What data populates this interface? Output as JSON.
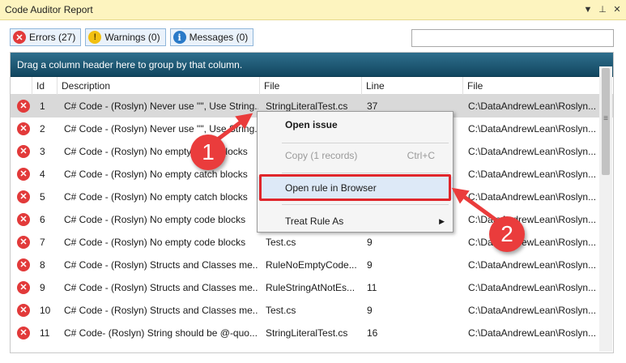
{
  "window": {
    "title": "Code Auditor Report",
    "dropdown_glyph": "▼",
    "pin_glyph": "⊥",
    "close_glyph": "✕"
  },
  "filters": {
    "errors_label": "Errors (27)",
    "warnings_label": "Warnings (0)",
    "messages_label": "Messages (0)",
    "error_icon_glyph": "✕",
    "warning_icon_glyph": "!",
    "info_icon_glyph": "i"
  },
  "search": {
    "value": "",
    "placeholder": ""
  },
  "grid": {
    "group_hint": "Drag a column header here to group by that column.",
    "columns": {
      "id": "Id",
      "description": "Description",
      "file": "File",
      "line": "Line",
      "file_path": "File"
    },
    "rows": [
      {
        "id": "1",
        "description": "C# Code - (Roslyn) Never use \"\", Use String...",
        "file": "StringLiteralTest.cs",
        "line": "37",
        "path": "C:\\DataAndrewLean\\Roslyn..."
      },
      {
        "id": "2",
        "description": "C# Code - (Roslyn) Never use \"\", Use String...",
        "file": "",
        "line": "",
        "path": "C:\\DataAndrewLean\\Roslyn..."
      },
      {
        "id": "3",
        "description": "C# Code - (Roslyn) No empty catch blocks",
        "file": "",
        "line": "",
        "path": "C:\\DataAndrewLean\\Roslyn..."
      },
      {
        "id": "4",
        "description": "C# Code - (Roslyn) No empty catch blocks",
        "file": "",
        "line": "",
        "path": "C:\\DataAndrewLean\\Roslyn..."
      },
      {
        "id": "5",
        "description": "C# Code - (Roslyn) No empty catch blocks",
        "file": "",
        "line": "",
        "path": "C:\\DataAndrewLean\\Roslyn..."
      },
      {
        "id": "6",
        "description": "C# Code - (Roslyn) No empty code blocks",
        "file": "",
        "line": "",
        "path": "C:\\DataAndrewLean\\Roslyn..."
      },
      {
        "id": "7",
        "description": "C# Code - (Roslyn) No empty code blocks",
        "file": "Test.cs",
        "line": "9",
        "path": "C:\\DataAndrewLean\\Roslyn..."
      },
      {
        "id": "8",
        "description": "C# Code - (Roslyn) Structs and Classes me...",
        "file": "RuleNoEmptyCode...",
        "line": "9",
        "path": "C:\\DataAndrewLean\\Roslyn..."
      },
      {
        "id": "9",
        "description": "C# Code - (Roslyn) Structs and Classes me...",
        "file": "RuleStringAtNotEs...",
        "line": "11",
        "path": "C:\\DataAndrewLean\\Roslyn..."
      },
      {
        "id": "10",
        "description": "C# Code - (Roslyn) Structs and Classes me...",
        "file": "Test.cs",
        "line": "9",
        "path": "C:\\DataAndrewLean\\Roslyn..."
      },
      {
        "id": "11",
        "description": "C# Code- (Roslyn) String should be @-quo...",
        "file": "StringLiteralTest.cs",
        "line": "16",
        "path": "C:\\DataAndrewLean\\Roslyn..."
      }
    ],
    "scroll_grip": "≡"
  },
  "context_menu": {
    "open_issue": "Open issue",
    "copy": "Copy (1 records)",
    "copy_shortcut": "Ctrl+C",
    "open_rule": "Open rule in Browser",
    "treat_rule": "Treat Rule As",
    "submenu_arrow": "▶"
  },
  "annotations": {
    "step1": "1",
    "step2": "2",
    "color": "#ea3c3c"
  }
}
